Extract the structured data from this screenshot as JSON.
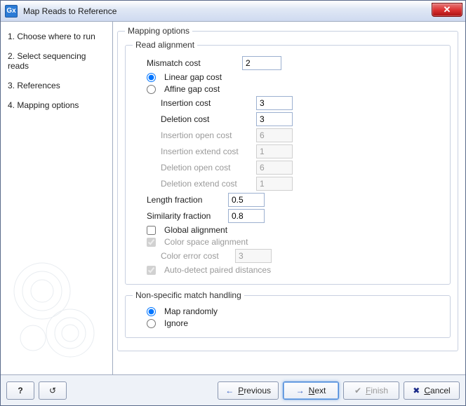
{
  "window": {
    "app_icon_label": "Gx",
    "title": "Map Reads to Reference"
  },
  "sidebar": {
    "steps": [
      "1.  Choose where to run",
      "2.  Select sequencing reads",
      "3.  References",
      "4.  Mapping options"
    ]
  },
  "content": {
    "mapping_legend": "Mapping options",
    "read_alignment_legend": "Read alignment",
    "mismatch_cost_label": "Mismatch cost",
    "mismatch_cost_value": "2",
    "linear_gap_label": "Linear gap cost",
    "affine_gap_label": "Affine gap cost",
    "gap_selected": "linear",
    "insertion_cost_label": "Insertion cost",
    "insertion_cost_value": "3",
    "deletion_cost_label": "Deletion cost",
    "deletion_cost_value": "3",
    "insertion_open_label": "Insertion open cost",
    "insertion_open_value": "6",
    "insertion_extend_label": "Insertion extend cost",
    "insertion_extend_value": "1",
    "deletion_open_label": "Deletion open cost",
    "deletion_open_value": "6",
    "deletion_extend_label": "Deletion extend cost",
    "deletion_extend_value": "1",
    "length_fraction_label": "Length fraction",
    "length_fraction_value": "0.5",
    "similarity_fraction_label": "Similarity fraction",
    "similarity_fraction_value": "0.8",
    "global_alignment_label": "Global alignment",
    "global_alignment_checked": false,
    "color_space_label": "Color space alignment",
    "color_space_checked": true,
    "color_error_label": "Color error cost",
    "color_error_value": "3",
    "auto_detect_label": "Auto-detect paired distances",
    "auto_detect_checked": true,
    "nonspecific_legend": "Non-specific match handling",
    "map_randomly_label": "Map randomly",
    "ignore_label": "Ignore",
    "nonspecific_selected": "random"
  },
  "footer": {
    "help_label": "?",
    "previous_label": "Previous",
    "next_label": "Next",
    "finish_label": "Finish",
    "cancel_label": "Cancel"
  }
}
